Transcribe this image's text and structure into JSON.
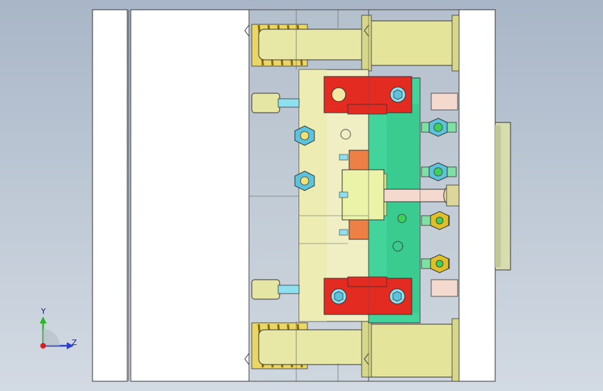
{
  "viewport": {
    "name": "3D model view"
  },
  "triad": {
    "y_label": "Y",
    "z_label": "Z"
  },
  "colors": {
    "plate": "#ffffff",
    "yellow": "#f0efc4",
    "red": "#e32b22",
    "green": "#42d49a",
    "orange": "#ee7f45",
    "cyan": "#8fe0ef",
    "spring": "#e0c028",
    "pillar": "#e7e8a6",
    "pink": "#f4d9cf",
    "edge": "#2b2b2b"
  }
}
